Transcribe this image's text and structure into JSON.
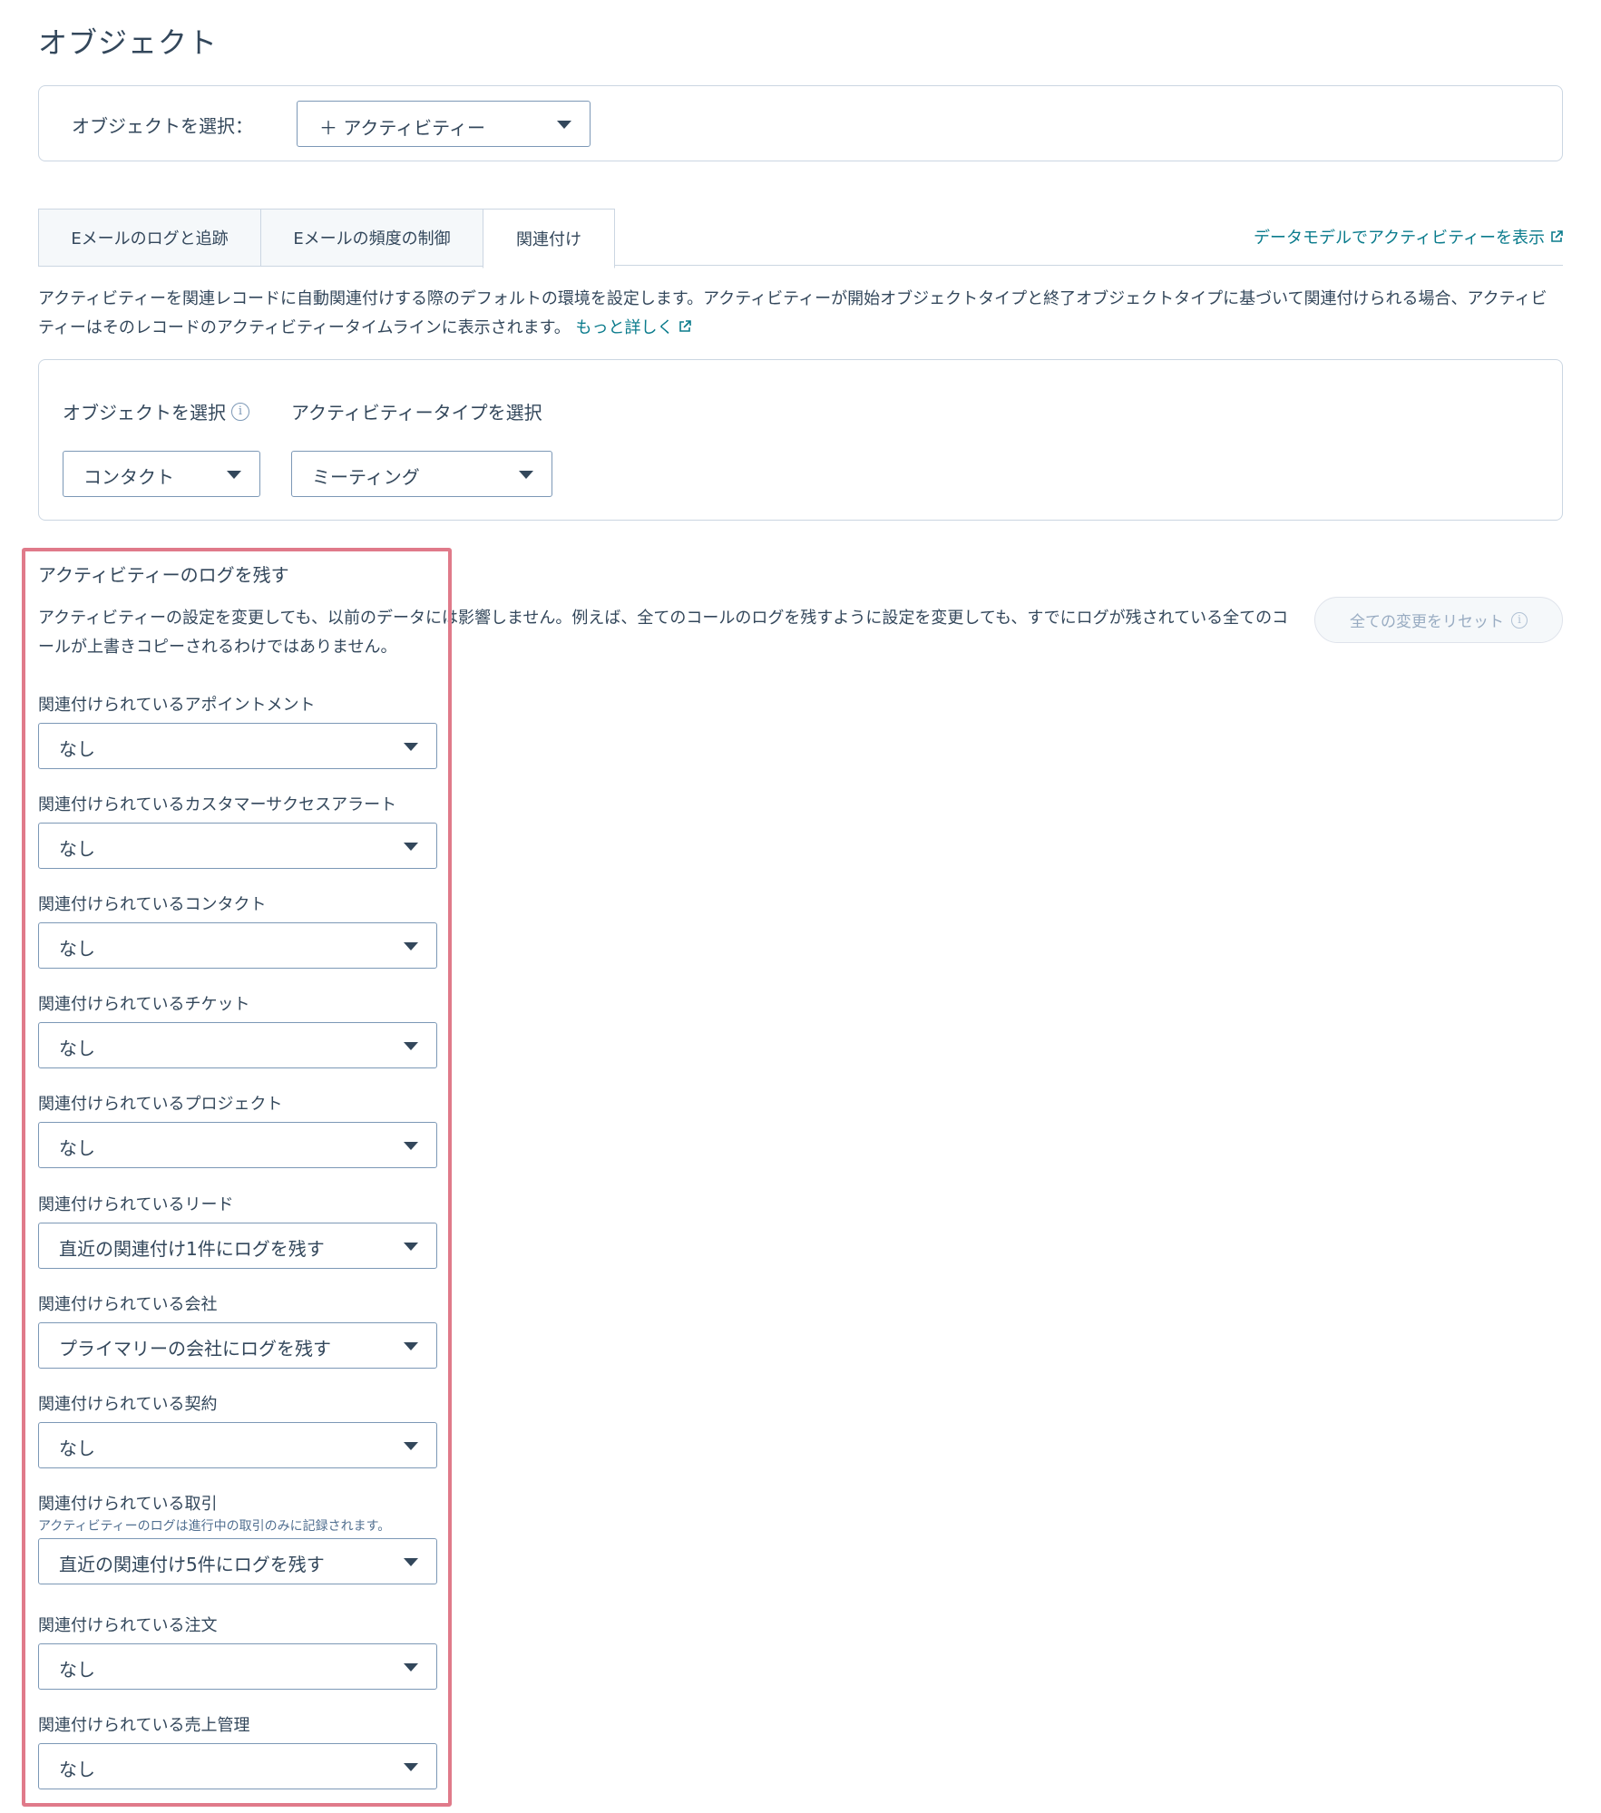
{
  "page_title": "オブジェクト",
  "object_selector": {
    "label": "オブジェクトを選択：",
    "value": "＋ アクティビティー"
  },
  "tabs": [
    {
      "label": "Eメールのログと追跡"
    },
    {
      "label": "Eメールの頻度の制御"
    },
    {
      "label": "関連付け"
    }
  ],
  "data_model_link": "データモデルでアクティビティーを表示",
  "description": "アクティビティーを関連レコードに自動関連付けする際のデフォルトの環境を設定します。アクティビティーが開始オブジェクトタイプと終了オブジェクトタイプに基づいて関連付けられる場合、アクティビティーはそのレコードのアクティビティータイムラインに表示されます。",
  "learn_more": "もっと詳しく",
  "filters": {
    "object_label": "オブジェクトを選択",
    "object_value": "コンタクト",
    "type_label": "アクティビティータイプを選択",
    "type_value": "ミーティング"
  },
  "log_section": {
    "title": "アクティビティーのログを残す",
    "description": "アクティビティーの設定を変更しても、以前のデータには影響しません。例えば、全てのコールのログを残すように設定を変更しても、すでにログが残されている全てのコールが上書きコピーされるわけではありません。",
    "reset_label": "全ての変更をリセット"
  },
  "fields": [
    {
      "label": "関連付けられているアポイントメント",
      "help": "",
      "value": "なし"
    },
    {
      "label": "関連付けられているカスタマーサクセスアラート",
      "help": "",
      "value": "なし"
    },
    {
      "label": "関連付けられているコンタクト",
      "help": "",
      "value": "なし"
    },
    {
      "label": "関連付けられているチケット",
      "help": "",
      "value": "なし"
    },
    {
      "label": "関連付けられているプロジェクト",
      "help": "",
      "value": "なし"
    },
    {
      "label": "関連付けられているリード",
      "help": "",
      "value": "直近の関連付け1件にログを残す"
    },
    {
      "label": "関連付けられている会社",
      "help": "",
      "value": "プライマリーの会社にログを残す"
    },
    {
      "label": "関連付けられている契約",
      "help": "",
      "value": "なし"
    },
    {
      "label": "関連付けられている取引",
      "help": "アクティビティーのログは進行中の取引のみに記録されます。",
      "value": "直近の関連付け5件にログを残す"
    },
    {
      "label": "関連付けられている注文",
      "help": "",
      "value": "なし"
    },
    {
      "label": "関連付けられている売上管理",
      "help": "",
      "value": "なし"
    }
  ],
  "colors": {
    "text": "#33475b",
    "link": "#0a7b8c",
    "border": "#cbd6e2",
    "highlight": "#e07a8a"
  }
}
